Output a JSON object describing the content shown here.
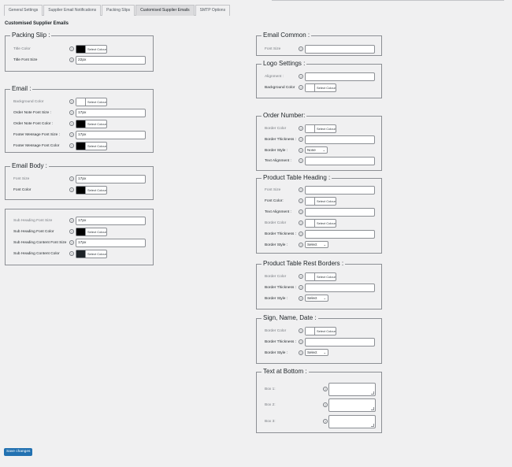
{
  "tabs": [
    "General Settings",
    "Supplier Email Notifications",
    "Packing Slips",
    "Customised Supplier Emails",
    "SMTP Options"
  ],
  "page_title": "Customised Supplier Emails",
  "help_icon": "?",
  "color_button_label": "Select Colour",
  "select_chevron": "⌄",
  "save_label": "Save changes",
  "packing_slip": {
    "title": "Packing Slip :",
    "title_color": "Title Color",
    "title_font_size": "Title Font Size",
    "title_font_size_value": "22px"
  },
  "email": {
    "title": "Email :",
    "bg_color": "Background Color",
    "order_note_font_size": "Order Note Font Size :",
    "order_note_font_size_value": "17px",
    "order_note_font_color": "Order Note Font Color :",
    "footer_font_size": "Footer Message Font Size :",
    "footer_font_size_value": "17px",
    "footer_font_color": "Footer Message Font Color"
  },
  "email_body": {
    "title": "Email Body :",
    "font_size": "Font Size",
    "font_size_value": "17px",
    "font_color": "Font Color"
  },
  "sub_heading": {
    "sh_font_size": "Sub Heading Font Size",
    "sh_font_size_value": "17px",
    "sh_font_color": "Sub Heading Font Color",
    "shc_font_size": "Sub Heading Content Font Size",
    "shc_font_size_value": "17px",
    "shc_color": "Sub Heading Content Color"
  },
  "email_common": {
    "title": "Email Common :",
    "font_size": "Font Size"
  },
  "logo_settings": {
    "title": "Logo Settings :",
    "alignment": "Alignment :",
    "bg_color": "Background Color"
  },
  "order_number": {
    "title": "Order Number:",
    "border_color": "Border Color",
    "border_thickness": "Border Thickness :",
    "border_style": "Border Style :",
    "border_style_value": "None",
    "text_alignment": "Text Alignment :"
  },
  "product_heading": {
    "title": "Product Table Heading :",
    "font_size": "Font Size",
    "font_color": "Font Color:",
    "text_alignment": "Text Alignment :",
    "border_color": "Border Color",
    "border_thickness": "Border Thickness :",
    "border_style": "Border Style :",
    "border_style_value": "Select"
  },
  "product_rest": {
    "title": "Product Table Rest Borders :",
    "border_color": "Border Color",
    "border_thickness": "Border Thickness :",
    "border_style": "Border Style :",
    "border_style_value": "Select"
  },
  "sign": {
    "title": "Sign, Name, Date :",
    "border_color": "Border Color",
    "border_thickness": "Border Thickness :",
    "border_style": "Border Style :",
    "border_style_value": "Select"
  },
  "text_bottom": {
    "title": "Text at Bottom :",
    "box1": "Box 1:",
    "box2": "Box 2:",
    "box3": "Box 3:"
  }
}
